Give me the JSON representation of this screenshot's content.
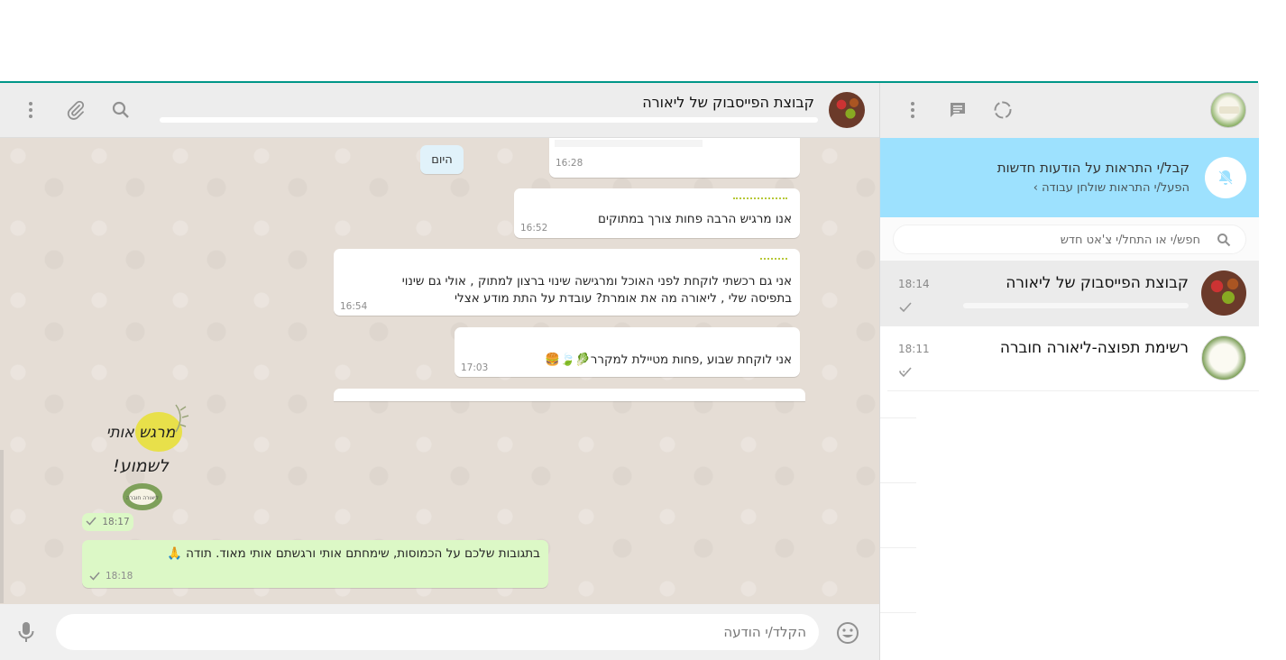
{
  "sidebar": {
    "notification": {
      "title": "קבל/י התראות על הודעות חדשות",
      "link": "הפעל/י התראות שולחן עבודה ›"
    },
    "search": {
      "placeholder": "חפש/י או התחל/י צ'אט חדש"
    },
    "chats": [
      {
        "name": "קבוצת הפייסבוק של ליאורה",
        "time": "18:14",
        "preview": ""
      },
      {
        "name": "רשימת תפוצה-ליאורה חוברה",
        "time": "18:11",
        "preview": "..."
      }
    ]
  },
  "main": {
    "title": "קבוצת הפייסבוק של ליאורה",
    "day_badge": "היום",
    "messages": [
      {
        "text": "",
        "time": "16:28"
      },
      {
        "text": "אנו מרגיש הרבה פחות צורך במתוקים",
        "time": "16:52"
      },
      {
        "line1": "אני גם רכשתי לוקחת לפני האוכל ומרגישה שינוי ברצון למתוק , אולי גם שינוי",
        "line2": "בתפיסה שלי , ליאורה מה את אומרת? עובדת על התת מודע אצלי",
        "time": "16:54"
      },
      {
        "text": "אני לוקחת שבוע ,פחות מטיילת למקרר🥬🍃🍔",
        "time": "17:03"
      }
    ],
    "sticker": {
      "line1": "מרגש אותי",
      "line2": "לשמוע!",
      "logo": "ליאורה חוברה",
      "time": "18:17"
    },
    "own_message": {
      "text": "בתגובות שלכם על הכמוסות, שימחתם אותי ורגשתם אותי מאוד. תודה 🙏",
      "time": "18:18"
    },
    "composer": {
      "placeholder": "הקלד/י הודעה"
    }
  },
  "colors": {
    "accent": "#009688",
    "outgoing": "#dcf8c6",
    "incoming": "#ffffff",
    "notif_bg": "#9de1fe",
    "chat_bg": "#e5ddd5"
  }
}
